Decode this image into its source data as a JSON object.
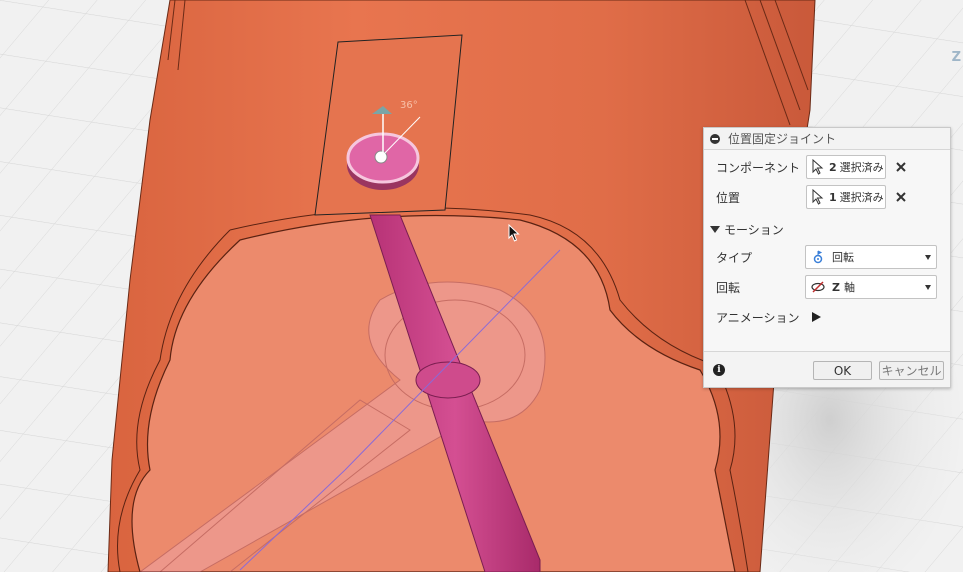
{
  "viewport": {
    "angle_annotation": "36°",
    "viewcube_axis_label": "Z"
  },
  "dialog": {
    "title": "位置固定ジョイント",
    "component": {
      "label": "コンポーネント",
      "count": "2",
      "text": "選択済み"
    },
    "position": {
      "label": "位置",
      "count": "1",
      "text": "選択済み"
    },
    "motion_section": {
      "label": "モーション"
    },
    "type": {
      "label": "タイプ",
      "value": "回転"
    },
    "rotation": {
      "label": "回転",
      "value_bold": "Z",
      "value": "軸"
    },
    "animation": {
      "label": "アニメーション"
    },
    "ok_label": "OK",
    "cancel_label": "キャンセル"
  },
  "colors": {
    "accent_orange": "#E3714F",
    "accent_pink": "#C63A82",
    "flag_teal": "#7AA5A6"
  }
}
